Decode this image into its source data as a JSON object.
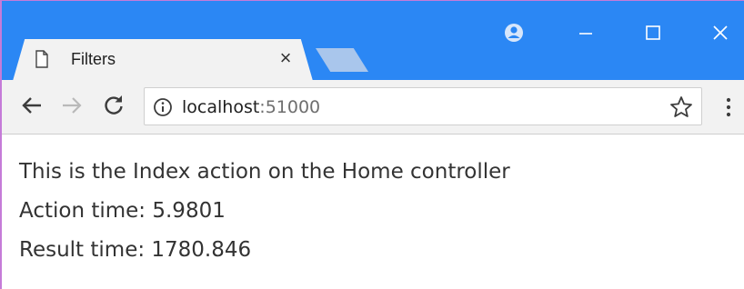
{
  "tab": {
    "title": "Filters",
    "close_symbol": "×"
  },
  "window_controls": {
    "profile_icon": "profile-icon",
    "minimize_icon": "minimize-icon",
    "maximize_icon": "maximize-icon",
    "close_icon": "close-icon"
  },
  "toolbar": {
    "back_icon": "back-arrow-icon",
    "forward_icon": "forward-arrow-icon",
    "reload_icon": "reload-icon",
    "url_host": "localhost",
    "url_port": ":51000",
    "bookmark_icon": "star-icon",
    "menu_icon": "more-menu-icon"
  },
  "page": {
    "line1": "This is the Index action on the Home controller",
    "line2": "Action time: 5.9801",
    "line3": "Result time: 1780.846"
  },
  "colors": {
    "titlebar": "#2b87f4",
    "toolbar": "#f2f2f2",
    "text": "#333333"
  }
}
